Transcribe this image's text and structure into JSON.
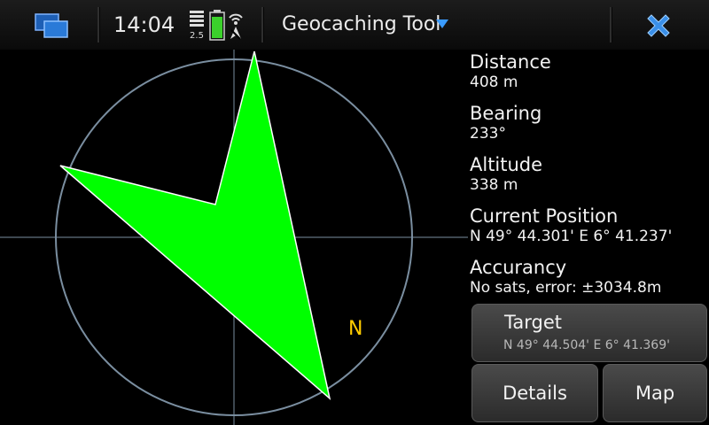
{
  "statusbar": {
    "time": "14:04",
    "signal_text": "2.5",
    "app_title": "Geocaching Tool",
    "icons": {
      "task_switcher": "task-switcher-icon",
      "battery": "battery-icon",
      "gps": "gps-icon",
      "menu": "dropdown-arrow-icon",
      "close": "close-icon"
    }
  },
  "compass": {
    "north_label": "N",
    "arrow_color": "#00ff00",
    "ring_color": "#7a8ea0",
    "north_color": "#ffcc00"
  },
  "info": {
    "distance_label": "Distance",
    "distance_value": "408 m",
    "bearing_label": "Bearing",
    "bearing_value": "233°",
    "altitude_label": "Altitude",
    "altitude_value": "338 m",
    "position_label": "Current Position",
    "position_value": "N 49° 44.301' E 6° 41.237'",
    "accuracy_label": "Accurancy",
    "accuracy_value": "No sats, error: ±3034.8m"
  },
  "buttons": {
    "target_label": "Target",
    "target_coords": "N 49° 44.504' E 6° 41.369'",
    "details_label": "Details",
    "map_label": "Map"
  }
}
